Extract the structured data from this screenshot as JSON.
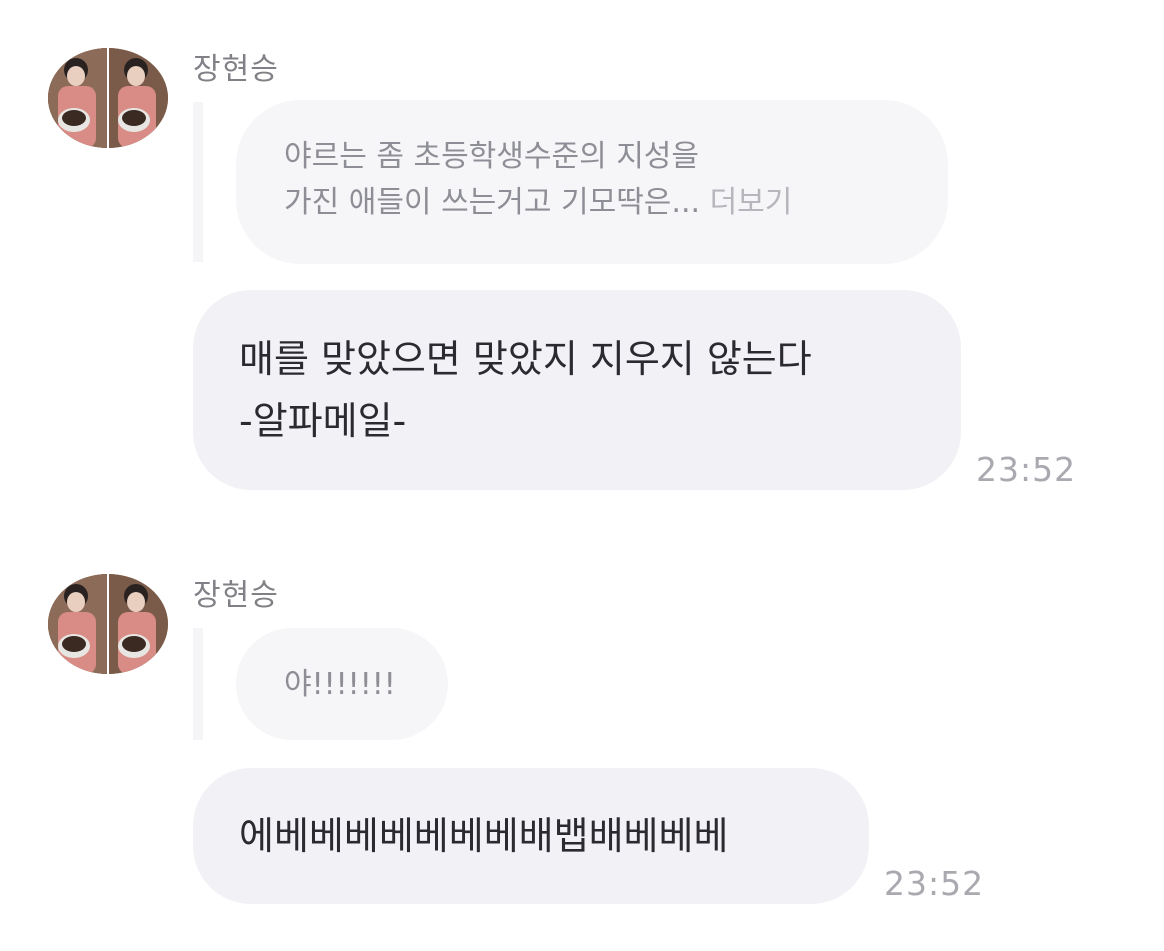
{
  "messages": [
    {
      "sender": "장현승",
      "reply_line1": "야르는 좀 초등학생수준의 지성을",
      "reply_line2": "가진 애들이 쓰는거고 기모딱은...",
      "reply_more": "더보기",
      "text_line1": "매를 맞았으면 맞았지 지우지 않는다",
      "text_line2": "-알파메일-",
      "time": "23:52"
    },
    {
      "sender": "장현승",
      "reply_line1": "야!!!!!!!",
      "text_line1": "에베베베베베베베배뱁배베베베",
      "time": "23:52"
    }
  ],
  "colors": {
    "bubble": "#f2f2f6",
    "reply_bubble": "#f6f6f9",
    "sender_text": "#808086",
    "timestamp": "#a9a9b0"
  },
  "icons": {
    "avatar": "profile-photo"
  }
}
